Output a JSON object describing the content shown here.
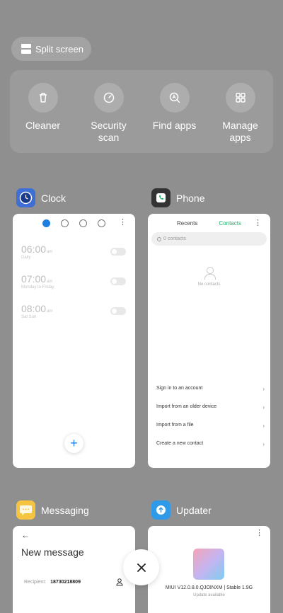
{
  "split_screen": {
    "label": "Split screen"
  },
  "tools": [
    {
      "label": "Cleaner",
      "icon": "trash-icon"
    },
    {
      "label": "Security\nscan",
      "icon": "security-scan-icon"
    },
    {
      "label": "Find apps",
      "icon": "find-apps-icon"
    },
    {
      "label": "Manage\napps",
      "icon": "grid-icon"
    }
  ],
  "apps": {
    "clock": {
      "name": "Clock",
      "alarms": [
        {
          "time": "06:00",
          "ampm": "am",
          "sub": "Daily"
        },
        {
          "time": "07:00",
          "ampm": "am",
          "sub": "Monday to Friday"
        },
        {
          "time": "08:00",
          "ampm": "am",
          "sub": "Sat Sun"
        }
      ],
      "fab": "+"
    },
    "phone": {
      "name": "Phone",
      "tab_recents": "Recents",
      "tab_contacts": "Contacts",
      "search_placeholder": "0 contacts",
      "empty": "No contacts",
      "rows": [
        "Sign in to an account",
        "Import from an older device",
        "Import from a file",
        "Create a new contact"
      ]
    },
    "messaging": {
      "name": "Messaging",
      "title": "New message",
      "recipient_label": "Recipient:",
      "recipient_value": "18730218809"
    },
    "updater": {
      "name": "Updater",
      "version": "MIUI V12.0.8.0.QJOINXM | Stable 1.9G",
      "status": "Update available"
    }
  },
  "colors": {
    "accent_blue": "#1e7fe0",
    "contacts_green": "#16b66a"
  }
}
